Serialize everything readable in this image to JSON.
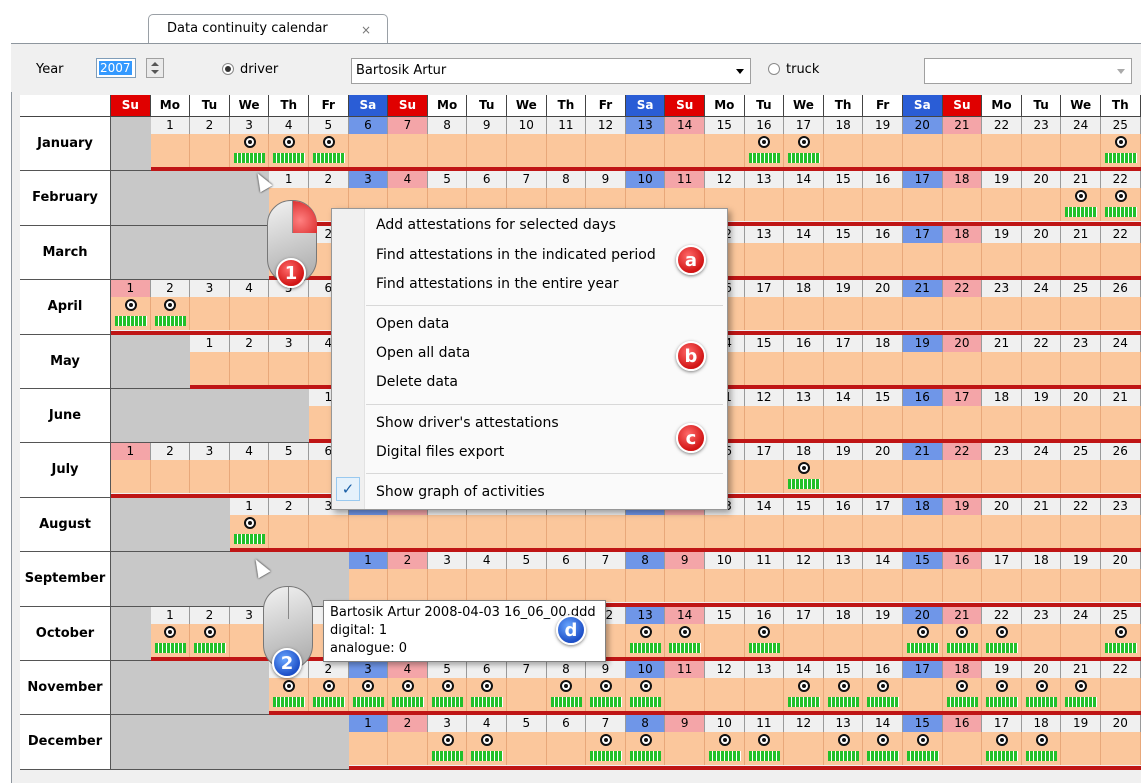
{
  "tab": {
    "title": "Data continuity calendar",
    "close_glyph": "×"
  },
  "toolbar": {
    "year_label": "Year",
    "year_value": "2007",
    "driver_label": "driver",
    "driver_selected": true,
    "driver_name": "Bartosik Artur",
    "truck_label": "truck",
    "truck_selected": false,
    "truck_value": ""
  },
  "weekday_headers": [
    "Su",
    "Mo",
    "Tu",
    "We",
    "Th",
    "Fr",
    "Sa",
    "Su",
    "Mo",
    "Tu",
    "We",
    "Th",
    "Fr",
    "Sa",
    "Su",
    "Mo",
    "Tu",
    "We",
    "Th",
    "Fr",
    "Sa",
    "Su",
    "Mo",
    "Tu",
    "We",
    "Th"
  ],
  "months": [
    {
      "name": "January",
      "offset": 1,
      "days": 25
    },
    {
      "name": "February",
      "offset": 4,
      "days": 22
    },
    {
      "name": "March",
      "offset": 4,
      "days": 22
    },
    {
      "name": "April",
      "offset": 0,
      "days": 26
    },
    {
      "name": "May",
      "offset": 2,
      "days": 24
    },
    {
      "name": "June",
      "offset": 5,
      "days": 21
    },
    {
      "name": "July",
      "offset": 0,
      "days": 26
    },
    {
      "name": "August",
      "offset": 3,
      "days": 23
    },
    {
      "name": "September",
      "offset": 6,
      "days": 20
    },
    {
      "name": "October",
      "offset": 1,
      "days": 25
    },
    {
      "name": "November",
      "offset": 4,
      "days": 22
    },
    {
      "name": "December",
      "offset": 6,
      "days": 20
    }
  ],
  "context_menu": {
    "group_a": [
      "Add attestations for selected days",
      "Find attestations in the indicated period",
      "Find attestations in the entire year"
    ],
    "group_b": [
      "Open data",
      "Open all data",
      "Delete data"
    ],
    "group_c": [
      "Show driver's attestations",
      "Digital files export"
    ],
    "checked_item": "Show graph of activities",
    "checked": true
  },
  "badges": {
    "a": "a",
    "b": "b",
    "c": "c",
    "d": "d",
    "one": "1",
    "two": "2"
  },
  "tooltip": {
    "line1": "Bartosik Artur 2008-04-03 16_06_00.ddd",
    "line2": "digital: 1",
    "line3": "analogue: 0"
  },
  "colors": {
    "sunday_header": "#e00000",
    "saturday_header": "#2a5dd6",
    "sunday_cell": "#f4a5a8",
    "saturday_cell": "#6f96e8",
    "weekday_cell": "#fbc79c",
    "activity": "#22c02a"
  }
}
